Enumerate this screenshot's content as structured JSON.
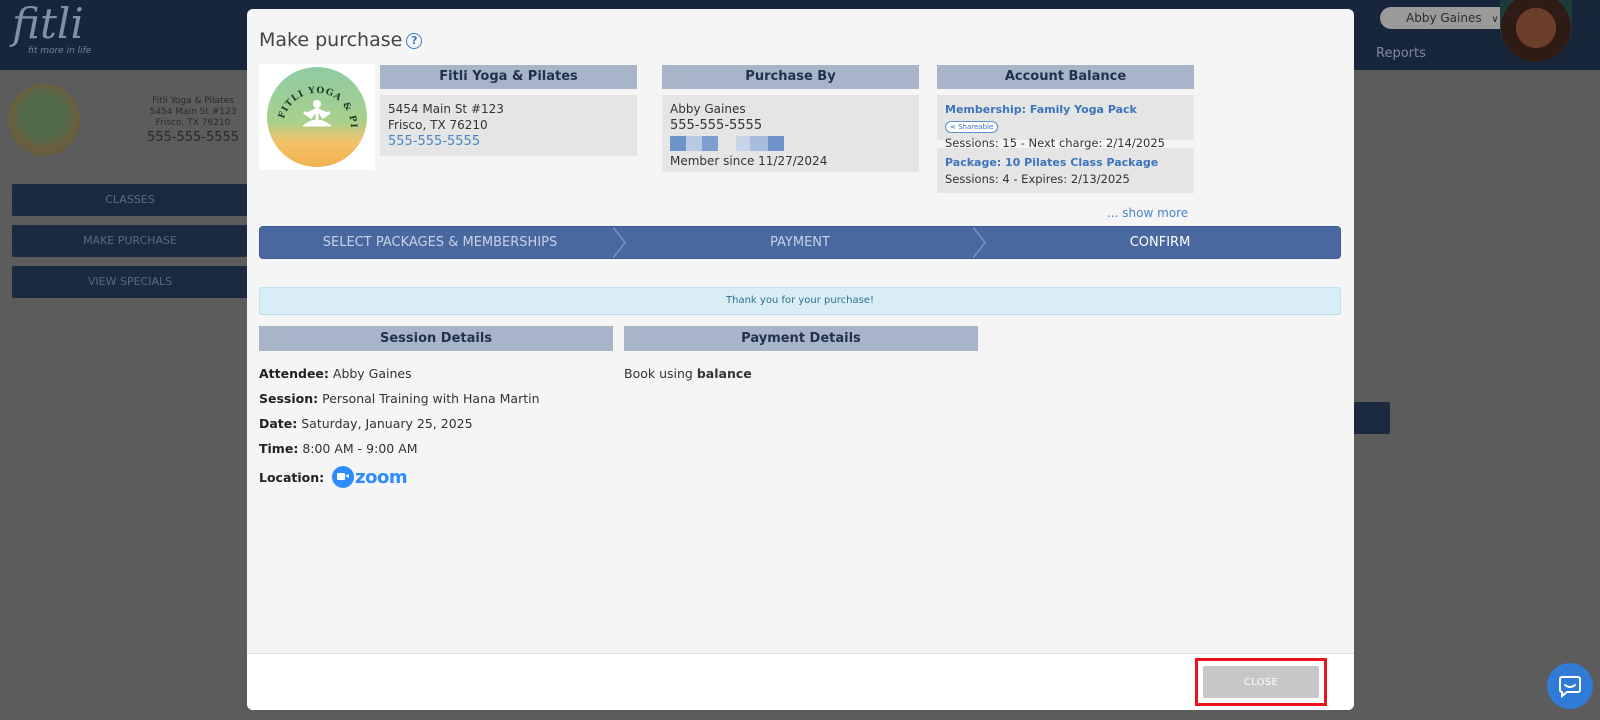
{
  "app": {
    "logo_text": "fitli",
    "tagline": "fit more in life",
    "user_name": "Abby Gaines",
    "user_caret": "∨",
    "nav_reports": "Reports"
  },
  "sidebar": {
    "studio_name": "Fitli Yoga & Pilates",
    "studio_address1": "5454 Main St #123",
    "studio_address2": "Frisco, TX 76210",
    "studio_phone": "555-555-5555",
    "nav": [
      {
        "label": "CLASSES"
      },
      {
        "label": "MAKE PURCHASE"
      },
      {
        "label": "VIEW SPECIALS"
      }
    ]
  },
  "modal": {
    "title": "Make purchase",
    "help_icon": "?",
    "studio_logo_ring_text": "FITLI YOGA & PILATES",
    "studio": {
      "header": "Fitli Yoga & Pilates",
      "address1": "5454 Main St #123",
      "address2": "Frisco, TX 76210",
      "phone": "555-555-5555"
    },
    "purchaser": {
      "header": "Purchase By",
      "name": "Abby Gaines",
      "phone": "555-555-5555",
      "member_since": "Member since 11/27/2024"
    },
    "balance": {
      "header": "Account Balance",
      "items": [
        {
          "name": "Membership: Family Yoga Pack",
          "badge": "Shareable",
          "detail": "Sessions: 15 -  Next charge: 2/14/2025"
        },
        {
          "name": "Package: 10 Pilates Class Package",
          "detail": "Sessions: 4 -  Expires: 2/13/2025"
        }
      ],
      "show_more": "... show more"
    },
    "steps": [
      {
        "label": "SELECT PACKAGES & MEMBERSHIPS",
        "active": false
      },
      {
        "label": "PAYMENT",
        "active": false
      },
      {
        "label": "CONFIRM",
        "active": true
      }
    ],
    "alert": "Thank you for your purchase!",
    "session": {
      "header": "Session Details",
      "attendee_label": "Attendee:",
      "attendee": "Abby Gaines",
      "session_label": "Session:",
      "session": "Personal Training with Hana Martin",
      "date_label": "Date:",
      "date": "Saturday, January 25, 2025",
      "time_label": "Time:",
      "time": "8:00 AM - 9:00 AM",
      "location_label": "Location:",
      "location_logo": "zoom"
    },
    "payment": {
      "header": "Payment Details",
      "text": "Book using",
      "method": "balance"
    },
    "footer": {
      "close_label": "CLOSE"
    }
  },
  "colors": {
    "accent": "#4a68a0",
    "header_bg": "#a8b4c8",
    "highlight": "#e8131b",
    "link": "#4a86c9"
  }
}
